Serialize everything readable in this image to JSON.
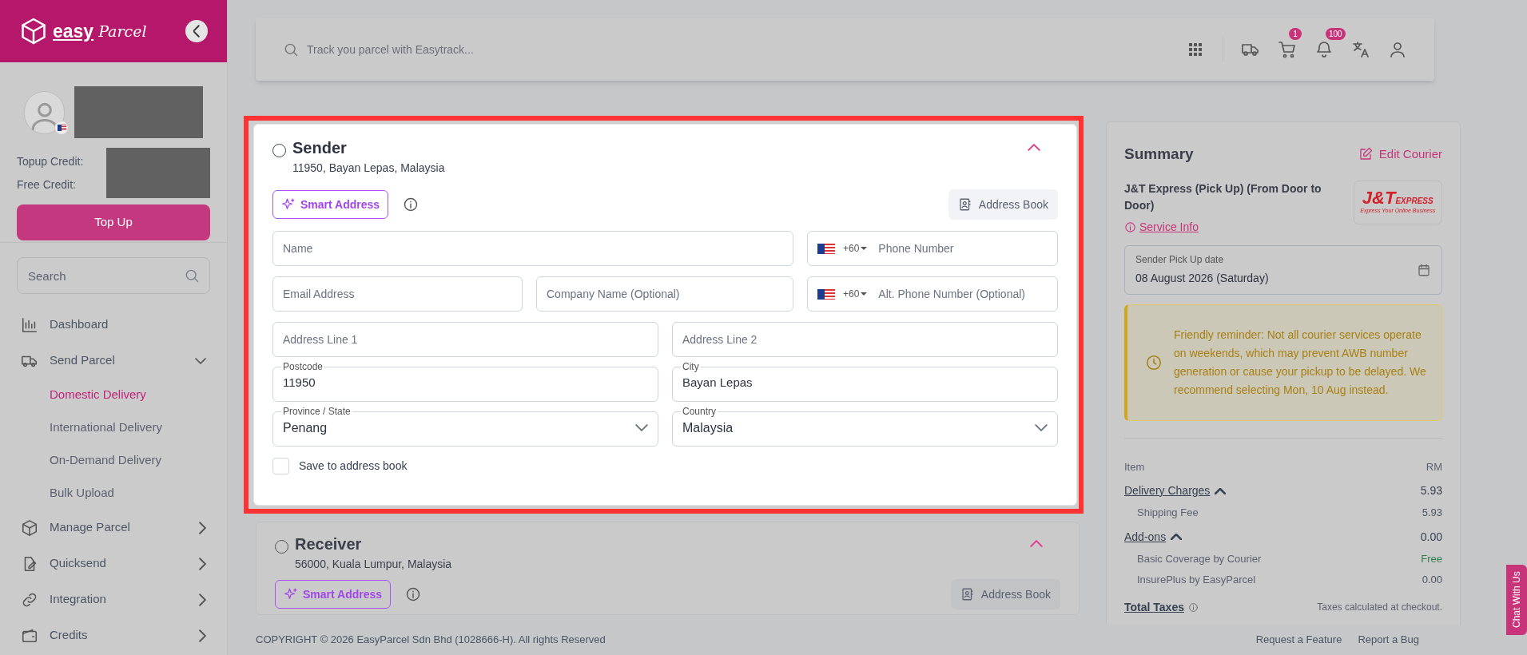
{
  "sidebar": {
    "logo": {
      "part_1": "easy",
      "part_2": "Parcel"
    },
    "credits": [
      {
        "label": "Topup Credit:"
      },
      {
        "label": "Free Credit:"
      }
    ],
    "top_up_button": "Top Up",
    "search": {
      "placeholder": "Search"
    },
    "nav": [
      {
        "label": "Dashboard",
        "kind": "link"
      },
      {
        "label": "Send Parcel",
        "kind": "group",
        "expanded": true,
        "children": [
          {
            "label": "Domestic Delivery",
            "selected": true
          },
          {
            "label": "International Delivery",
            "selected": false
          },
          {
            "label": "On-Demand Delivery",
            "selected": false
          },
          {
            "label": "Bulk Upload",
            "selected": false
          }
        ]
      },
      {
        "label": "Manage Parcel",
        "kind": "group",
        "expanded": false
      },
      {
        "label": "Quicksend",
        "kind": "group",
        "expanded": false
      },
      {
        "label": "Integration",
        "kind": "group",
        "expanded": false
      },
      {
        "label": "Credits",
        "kind": "group",
        "expanded": false
      }
    ]
  },
  "top_bar": {
    "search": {
      "placeholder": "Track you parcel with Easytrack..."
    },
    "cart_badge": "1",
    "notification_badge": "100"
  },
  "sender": {
    "selected": false,
    "title": "Sender",
    "address": "11950, Bayan Lepas, Malaysia",
    "expanded": true,
    "smart_address": "Smart Address",
    "address_book": "Address Book",
    "fields": {
      "name": {
        "kind": "text",
        "placeholder": "Name"
      },
      "phone": {
        "kind": "phone",
        "code": "+60",
        "placeholder": "Phone Number"
      },
      "email": {
        "kind": "text",
        "placeholder": "Email Address"
      },
      "company": {
        "kind": "text",
        "placeholder": "Company Name (Optional)"
      },
      "alt_phone": {
        "kind": "phone",
        "code": "+60",
        "placeholder": "Alt. Phone Number (Optional)"
      },
      "address_line_1": {
        "kind": "text",
        "placeholder": "Address Line 1"
      },
      "address_line_2": {
        "kind": "text",
        "placeholder": "Address Line 2"
      },
      "postcode": {
        "kind": "labeled",
        "label": "Postcode",
        "value": "11950"
      },
      "city": {
        "kind": "labeled",
        "label": "City",
        "value": "Bayan Lepas"
      },
      "state": {
        "kind": "select",
        "label": "Province / State",
        "value": "Penang"
      },
      "country": {
        "kind": "select",
        "label": "Country",
        "value": "Malaysia"
      }
    },
    "save_to_address_book": {
      "label": "Save to address book",
      "checked": false
    }
  },
  "receiver": {
    "selected": false,
    "title": "Receiver",
    "address": "56000, Kuala Lumpur, Malaysia",
    "expanded": true,
    "smart_address": "Smart Address",
    "address_book": "Address Book"
  },
  "summary": {
    "title": "Summary",
    "edit_courier": "Edit Courier",
    "courier_name": "J&T Express (Pick Up) (From Door to Door)",
    "service_info": "Service Info",
    "courier_logo": {
      "name": "J&T",
      "suffix": "EXPRESS",
      "tagline": "Express Your Online Business"
    },
    "pickup_date": {
      "label": "Sender Pick Up date",
      "value": "08 August 2026 (Saturday)"
    },
    "reminder": "Friendly reminder: Not all courier services operate on weekends, which may prevent AWB number generation or cause your pickup to be delayed. We recommend selecting Mon, 10 Aug instead.",
    "columns": [
      "Item",
      "RM"
    ],
    "groups": [
      {
        "label": "Delivery Charges",
        "amount": "5.93",
        "expanded": true,
        "items": [
          {
            "label": "Shipping Fee",
            "amount": "5.93",
            "color": "#4b5563"
          }
        ]
      },
      {
        "label": "Add-ons",
        "amount": "0.00",
        "expanded": true,
        "items": [
          {
            "label": "Basic Coverage by Courier",
            "amount": "Free",
            "color": "#2f7d4f"
          },
          {
            "label": "InsurePlus by EasyParcel",
            "amount": "0.00",
            "color": "#4b5563"
          }
        ]
      }
    ],
    "total_taxes": {
      "label": "Total Taxes",
      "note": "Taxes calculated at checkout."
    }
  },
  "footer": {
    "copyright": "COPYRIGHT © 2026 EasyParcel Sdn Bhd (1028666-H). All rights Reserved",
    "links": [
      "Request a Feature",
      "Report a Bug"
    ]
  },
  "chat_button": "Chat With Us"
}
